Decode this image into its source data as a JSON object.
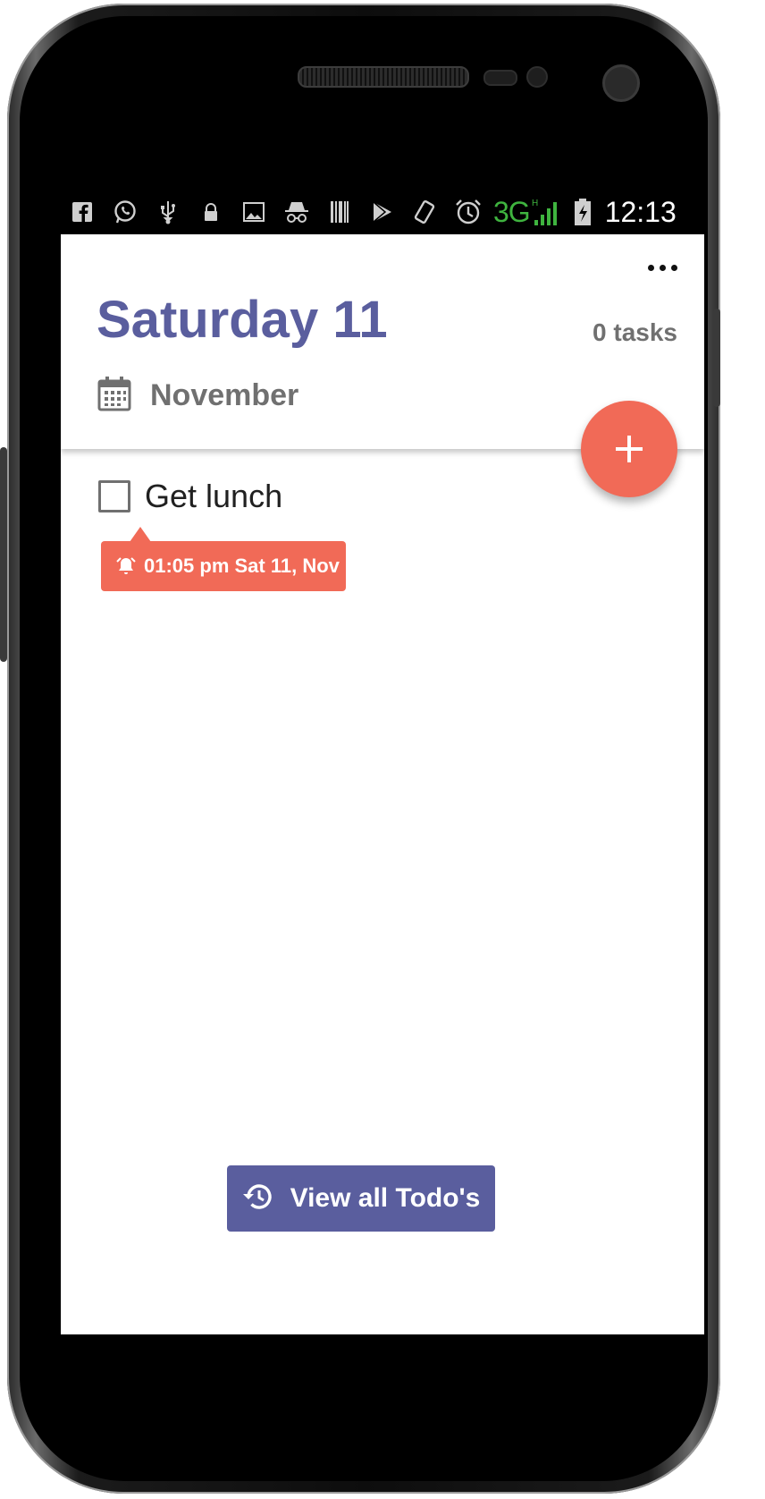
{
  "status_bar": {
    "icons": [
      "facebook-icon",
      "whatsapp-icon",
      "usb-icon",
      "lock-icon",
      "image-icon",
      "incognito-icon",
      "barcode-icon",
      "play-store-icon",
      "rotate-icon",
      "alarm-icon"
    ],
    "network_type": "3G",
    "time": "12:13"
  },
  "header": {
    "day_title": "Saturday 11",
    "month": "November",
    "task_count": "0 tasks"
  },
  "tasks": [
    {
      "title": "Get lunch",
      "checked": false,
      "reminder": "01:05 pm Sat 11, Nov"
    }
  ],
  "footer": {
    "view_all_label": "View all Todo's"
  },
  "colors": {
    "primary": "#5a5e9e",
    "accent": "#f16a57",
    "secondary_text": "#707070",
    "status_3g": "#3fb43f"
  }
}
